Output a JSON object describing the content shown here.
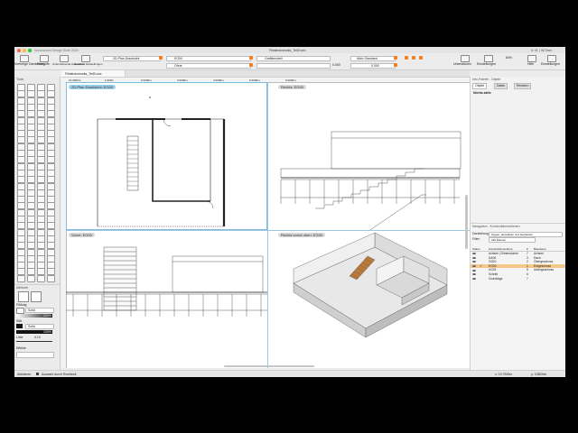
{
  "window": {
    "title": "Filmlectorworks_Teil3.vwx",
    "app": "Vectorworks Design Suite 2024"
  },
  "user": "A. M. | WiTown",
  "toolbar": {
    "left_buttons": [
      "Vorherige Darstellung",
      "Entwürfe",
      "Unterstützende Auswahlen",
      "Gesamte Darstellungen"
    ],
    "view_dropdown": "2D-Plan Draufsicht",
    "layer_dropdown": "EG00",
    "class_dropdown": "Ohne",
    "drawing_dropdown": "Grafikmodell",
    "scale_value": "0.000",
    "standard_dropdown": "Aktiv Standard",
    "zoom_value": "0.000",
    "right_buttons": [
      "Unterstützen",
      "Einstellungen",
      "Hilfe",
      "Einstellungen"
    ],
    "zoom_percent": "84%"
  },
  "tab": {
    "file": "Filmlectorworks_Teil3.vwx"
  },
  "palettes": {
    "tools_title": "Tools",
    "attributes_title": "Attribute",
    "fill_label": "Füllung",
    "fill_value": "Solid",
    "pen_label": "Stift",
    "pen_value": "Solid",
    "opacity_1": "100%",
    "opacity_2": "100%",
    "line_label": "Linie",
    "line_value": "0.10",
    "effects_label": "Effekte"
  },
  "rulers": {
    "top": [
      "10.0000m",
      "1.000m",
      "2.0000m",
      "3.0000m",
      "4.0000m",
      "5.0000m",
      "6.0000m"
    ]
  },
  "viewports": [
    {
      "label": "2D-Plan Draufsicht: EG00",
      "active": true
    },
    {
      "label": "Rechts: EG00",
      "active": false
    },
    {
      "label": "Vorne: EG00",
      "active": false
    },
    {
      "label": "Rechts vorne oben: EG00",
      "active": false
    }
  ],
  "obj_info": {
    "title": "Info-Palette - Objekt",
    "tabs": [
      "Objekt",
      "Daten",
      "Rendern"
    ],
    "status": "Nichts aktiv"
  },
  "navigation": {
    "title": "Navigation - Konstruktionsebenen",
    "display_label": "Darstellung:",
    "display_value": "Zeigen, auswählen und bearbeiten",
    "filter_label": "Filter:",
    "filter_value": "Alle Ebenen",
    "columns": [
      "Status",
      "Konstruktionsebene",
      "#",
      "Bauebene"
    ],
    "rows": [
      {
        "name": "Achsen | Dimensionen",
        "num": "7",
        "story": "Achsen",
        "active": false
      },
      {
        "name": "DA00",
        "num": "3",
        "story": "Dach",
        "active": false
      },
      {
        "name": "OG01",
        "num": "2",
        "story": "Obergeschoss",
        "active": false
      },
      {
        "name": "EG00",
        "num": "1",
        "story": "Erdgeschoss",
        "active": true
      },
      {
        "name": "UG01",
        "num": "5",
        "story": "Untergeschoss",
        "active": false
      },
      {
        "name": "Schnitt",
        "num": "6",
        "story": "",
        "active": false
      },
      {
        "name": "Grundlage",
        "num": "7",
        "story": "",
        "active": false
      }
    ]
  },
  "status": {
    "left": "Aktivieren",
    "mode": "Auswahl durch Rechteck",
    "x": "x: 19.7500m",
    "y": "y: 3.8500m"
  },
  "colors": {
    "accent": "#f0821e",
    "active_viewport": "#9fd0ea",
    "active_layer": "#f6c78a"
  }
}
